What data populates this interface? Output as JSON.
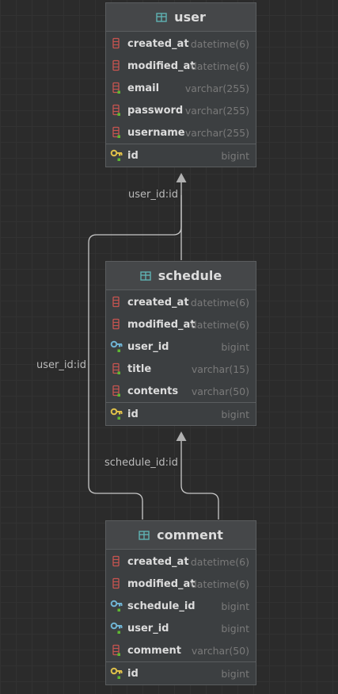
{
  "tables": {
    "user": {
      "name": "user",
      "columns": [
        {
          "name": "created_at",
          "type": "datetime(6)",
          "icon": "column-icon"
        },
        {
          "name": "modified_at",
          "type": "datetime(6)",
          "icon": "column-icon"
        },
        {
          "name": "email",
          "type": "varchar(255)",
          "icon": "column-not-null-icon"
        },
        {
          "name": "password",
          "type": "varchar(255)",
          "icon": "column-not-null-icon"
        },
        {
          "name": "username",
          "type": "varchar(255)",
          "icon": "column-not-null-icon"
        }
      ],
      "pk": {
        "name": "id",
        "type": "bigint",
        "icon": "primary-key-icon"
      }
    },
    "schedule": {
      "name": "schedule",
      "columns": [
        {
          "name": "created_at",
          "type": "datetime(6)",
          "icon": "column-icon"
        },
        {
          "name": "modified_at",
          "type": "datetime(6)",
          "icon": "column-icon"
        },
        {
          "name": "user_id",
          "type": "bigint",
          "icon": "foreign-key-icon"
        },
        {
          "name": "title",
          "type": "varchar(15)",
          "icon": "column-not-null-icon"
        },
        {
          "name": "contents",
          "type": "varchar(50)",
          "icon": "column-not-null-icon"
        }
      ],
      "pk": {
        "name": "id",
        "type": "bigint",
        "icon": "primary-key-icon"
      }
    },
    "comment": {
      "name": "comment",
      "columns": [
        {
          "name": "created_at",
          "type": "datetime(6)",
          "icon": "column-icon"
        },
        {
          "name": "modified_at",
          "type": "datetime(6)",
          "icon": "column-icon"
        },
        {
          "name": "schedule_id",
          "type": "bigint",
          "icon": "foreign-key-icon"
        },
        {
          "name": "user_id",
          "type": "bigint",
          "icon": "foreign-key-icon"
        },
        {
          "name": "comment",
          "type": "varchar(50)",
          "icon": "column-not-null-icon"
        }
      ],
      "pk": {
        "name": "id",
        "type": "bigint",
        "icon": "primary-key-icon"
      }
    }
  },
  "relations": {
    "schedule_to_user": "user_id:id",
    "comment_to_user": "user_id:id",
    "comment_to_schedule": "schedule_id:id"
  },
  "colors": {
    "background": "#2b2b2b",
    "table_body": "#3c3f41",
    "table_header": "#454749",
    "border": "#5a5d5f",
    "column_icon": "#c75450",
    "foreign_key_icon": "#6fb3d2",
    "primary_key_icon": "#e0c14a",
    "not_null_marker": "#5fb832",
    "link_line": "#c8c8c8"
  }
}
